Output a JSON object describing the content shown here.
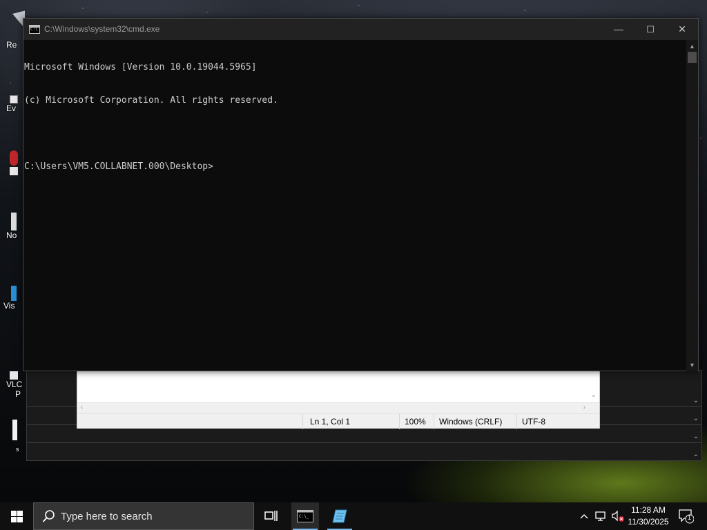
{
  "desktop": {
    "icons": [
      {
        "label": "Re",
        "icon": "recycle-bin-icon"
      },
      {
        "label": "Ev",
        "icon": "app-shortcut-icon"
      },
      {
        "label": "",
        "icon": "app-shortcut-icon"
      },
      {
        "label": "No",
        "icon": "notepad-shortcut-icon"
      },
      {
        "label": "Vis",
        "icon": "visual-studio-shortcut-icon"
      },
      {
        "label": "VLC",
        "icon": "vlc-shortcut-icon"
      },
      {
        "label": "P",
        "icon": ""
      },
      {
        "label": "s",
        "icon": ""
      }
    ]
  },
  "cmd_window": {
    "title": "C:\\Windows\\system32\\cmd.exe",
    "console_lines": [
      "Microsoft Windows [Version 10.0.19044.5965]",
      "(c) Microsoft Corporation. All rights reserved.",
      "",
      "C:\\Users\\VM5.COLLABNET.000\\Desktop>"
    ],
    "controls": {
      "minimize": "—",
      "maximize": "☐",
      "close": "✕"
    }
  },
  "notepad_window": {
    "status": {
      "position": "Ln 1, Col 1",
      "zoom": "100%",
      "line_ending": "Windows (CRLF)",
      "encoding": "UTF-8"
    }
  },
  "taskbar": {
    "search_placeholder": "Type here to search",
    "clock_time": "11:28 AM",
    "clock_date": "11/30/2025",
    "notification_count": "1",
    "accent_color": "#76b9ed"
  }
}
